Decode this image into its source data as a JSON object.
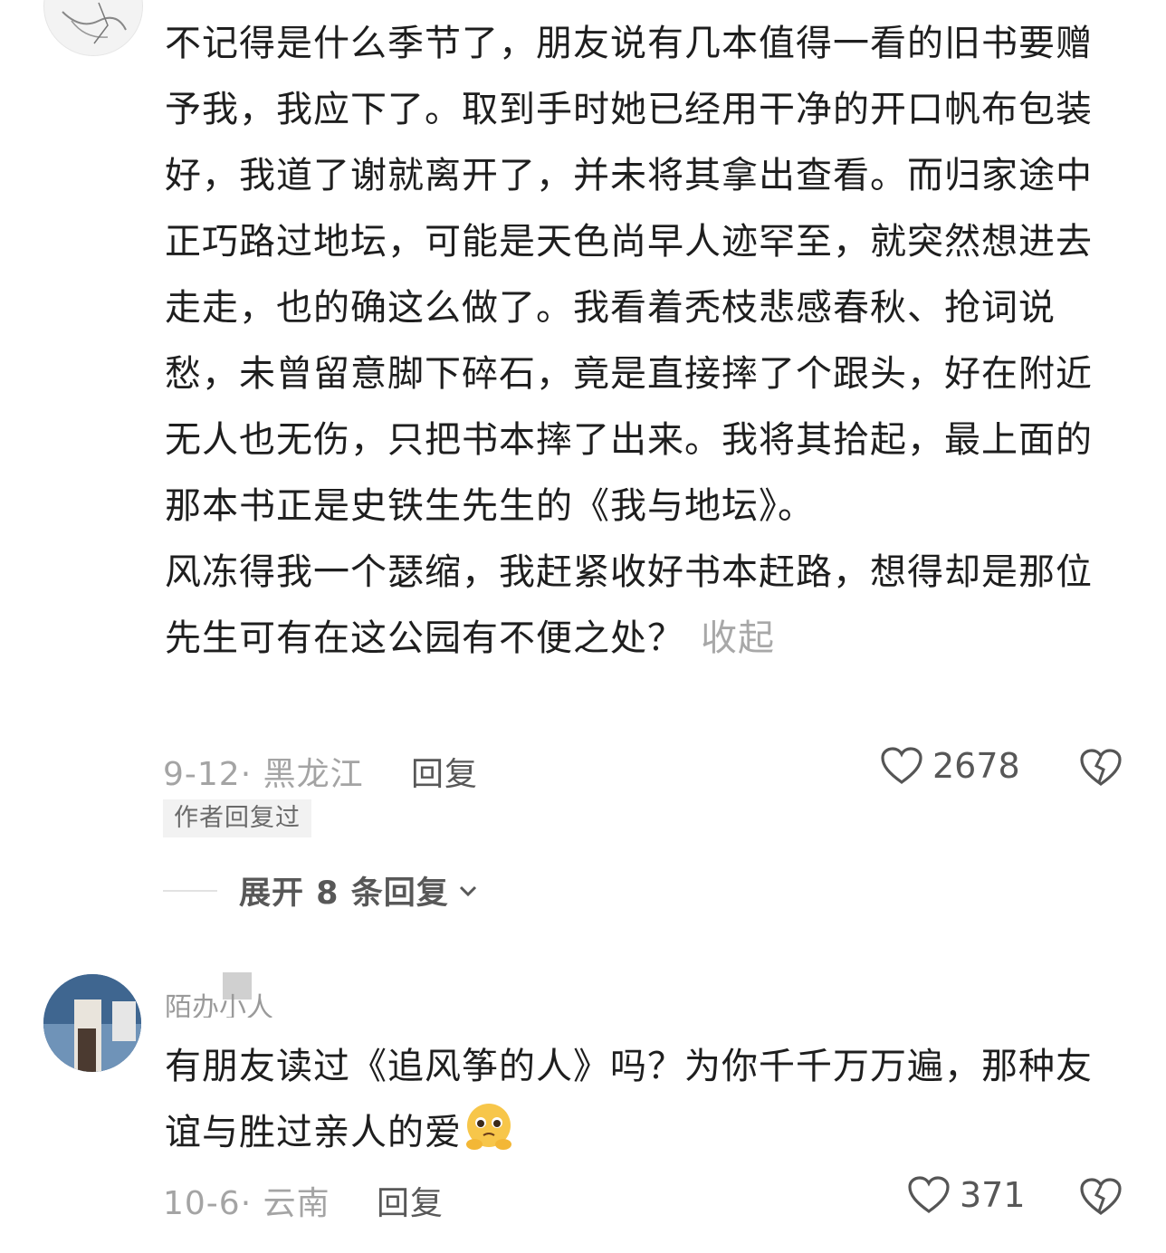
{
  "comment1": {
    "body": "不记得是什么季节了，朋友说有几本值得一看的旧书要赠予我，我应下了。取到手时她已经用干净的开口帆布包装好，我道了谢就离开了，并未将其拿出查看。而归家途中正巧路过地坛，可能是天色尚早人迹罕至，就突然想进去走走，也的确这么做了。我看着秃枝悲感春秋、抢词说愁，未曾留意脚下碎石，竟是直接摔了个跟头，好在附近无人也无伤，只把书本摔了出来。我将其拾起，最上面的那本书正是史铁生先生的《我与地坛》。\n风冻得我一个瑟缩，我赶紧收好书本赶路，想得却是那位先生可有在这公园有不便之处？",
    "collapse_label": "收起",
    "meta": "9-12· 黑龙江",
    "reply_label": "回复",
    "likes": "2678",
    "author_badge": "作者回复过",
    "expand_label": "展开 8 条回复"
  },
  "comment2": {
    "username": "陌办小人",
    "body": "有朋友读过《追风筝的人》吗？为你千千万万遍，那种友谊与胜过亲人的爱",
    "emoji": "pleading-face-emoji",
    "meta": "10-6· 云南",
    "reply_label": "回复",
    "likes": "371"
  },
  "colors": {
    "text": "#1e1e1e",
    "meta": "#a4a4a4",
    "badge_bg": "#f2f2f2",
    "emoji": "#f7c64a"
  }
}
